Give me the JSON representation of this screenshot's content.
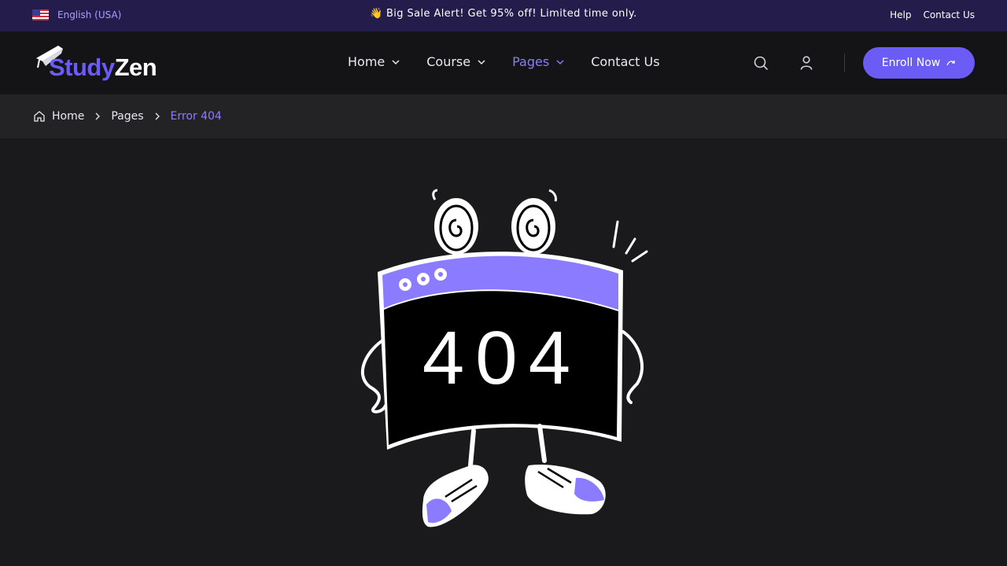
{
  "topbar": {
    "language": "English (USA)",
    "announcement": "Big Sale Alert! Get 95% off! Limited time only.",
    "announcement_icon": "waving-hand-icon",
    "links": [
      "Help",
      "Contact Us"
    ]
  },
  "header": {
    "logo": {
      "part1": "Study",
      "part2": "Zen"
    },
    "nav": [
      {
        "label": "Home",
        "has_dropdown": true,
        "active": false
      },
      {
        "label": "Course",
        "has_dropdown": true,
        "active": false
      },
      {
        "label": "Pages",
        "has_dropdown": true,
        "active": true
      },
      {
        "label": "Contact Us",
        "has_dropdown": false,
        "active": false
      }
    ],
    "icons": [
      "search-icon",
      "user-icon"
    ],
    "cta_label": "Enroll Now"
  },
  "breadcrumb": [
    "Home",
    "Pages",
    "Error 404"
  ],
  "illustration": {
    "text": "404"
  },
  "colors": {
    "accent": "#6b5cf6",
    "accent_light": "#8b7cff",
    "background": "#1a1a1d",
    "topbar": "#241d4c",
    "header": "#141417"
  }
}
